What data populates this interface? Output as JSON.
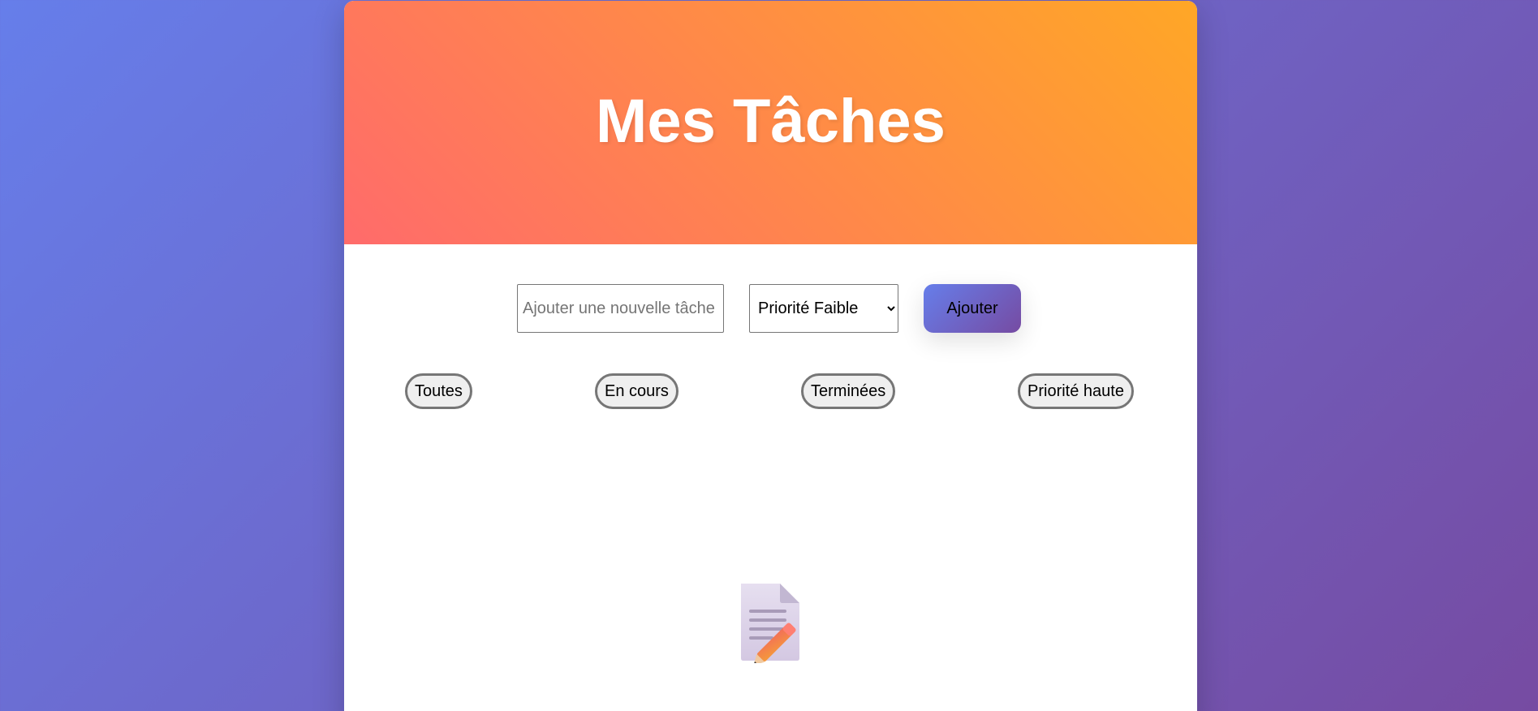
{
  "header": {
    "title": "Mes Tâches"
  },
  "add_form": {
    "input_value": "",
    "input_placeholder": "Ajouter une nouvelle tâche",
    "priority_selected": "Priorité Faible",
    "add_label": "Ajouter"
  },
  "filters": [
    {
      "label": "Toutes"
    },
    {
      "label": "En cours"
    },
    {
      "label": "Terminées"
    },
    {
      "label": "Priorité haute"
    }
  ],
  "empty_state": {
    "icon": "memo-icon"
  },
  "colors": {
    "background_start": "#667eea",
    "background_end": "#764ba2",
    "header_start": "#ff6b6b",
    "header_end": "#ffa726"
  }
}
